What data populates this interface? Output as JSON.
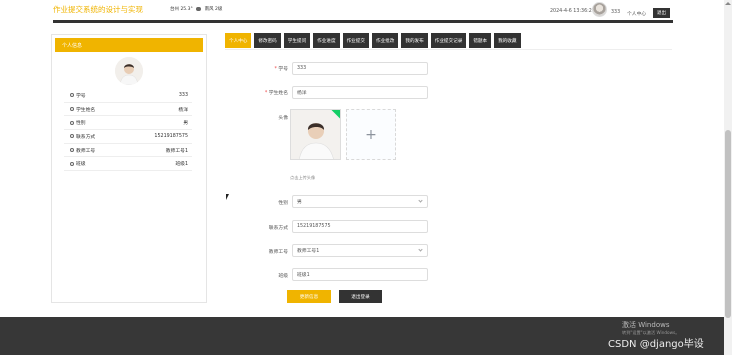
{
  "header": {
    "site_title": "作业提交系统的设计与实现",
    "weather_city": "台州",
    "weather_temp": "25.3°",
    "weather_wind": "南风",
    "weather_level": "2级",
    "datetime": "2024-4-6 13:36:27",
    "username": "333",
    "center_link": "个人中心",
    "logout_label": "退出"
  },
  "sidebar": {
    "title": "个人信息",
    "rows": [
      {
        "label": "学号",
        "value": "333"
      },
      {
        "label": "学生姓名",
        "value": "杨洋"
      },
      {
        "label": "性别",
        "value": "男"
      },
      {
        "label": "联系方式",
        "value": "15219187575"
      },
      {
        "label": "教师工号",
        "value": "教师工号1"
      },
      {
        "label": "班级",
        "value": "班级1"
      }
    ]
  },
  "tabs": [
    {
      "label": "个人中心",
      "active": true
    },
    {
      "label": "修改密码",
      "active": false
    },
    {
      "label": "学生提问",
      "active": false
    },
    {
      "label": "作业进度",
      "active": false
    },
    {
      "label": "作业提交",
      "active": false
    },
    {
      "label": "作业批改",
      "active": false
    },
    {
      "label": "我的发布",
      "active": false
    },
    {
      "label": "作业提交记录",
      "active": false
    },
    {
      "label": "错题本",
      "active": false
    },
    {
      "label": "我的收藏",
      "active": false
    }
  ],
  "form": {
    "student_no_label": "学号",
    "student_no_value": "333",
    "student_name_label": "学生姓名",
    "student_name_value": "杨洋",
    "avatar_label": "头像",
    "upload_plus": "+",
    "upload_tip": "点击上传头像",
    "gender_label": "性别",
    "gender_value": "男",
    "phone_label": "联系方式",
    "phone_value": "15219187575",
    "teacher_no_label": "教师工号",
    "teacher_no_value": "教师工号1",
    "class_label": "班级",
    "class_value": "班级1",
    "save_label": "更新信息",
    "exit_label": "退出登录"
  },
  "footer": {
    "activate_title": "激活 Windows",
    "activate_hint": "转到\"设置\"以激活 Windows。",
    "watermark": "CSDN @django毕设"
  },
  "colors": {
    "accent": "#f0b400",
    "dark": "#333333",
    "footer": "#373737"
  }
}
